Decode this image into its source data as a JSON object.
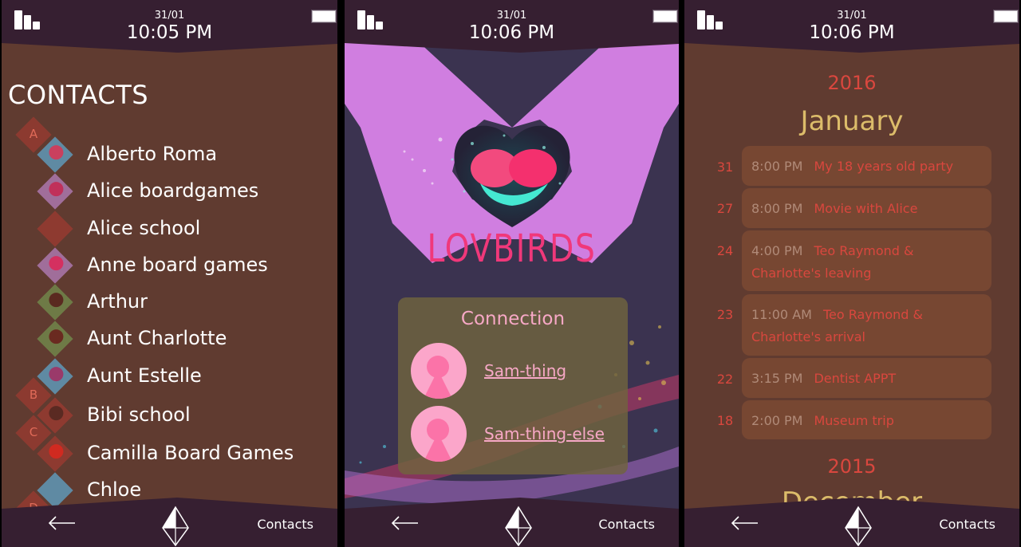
{
  "screens": [
    {
      "status": {
        "date": "31/01",
        "time": "10:05 PM",
        "signal_icon": "signal-bars-icon",
        "battery_icon": "battery-icon"
      },
      "title": "CONTACTS",
      "letters": [
        "A",
        "B",
        "C",
        "D"
      ],
      "contacts": [
        {
          "name": "Alberto Roma",
          "avatar_bg": "#5f8aa3",
          "avatar_fg": "#c9405e"
        },
        {
          "name": "Alice boardgames",
          "avatar_bg": "#a06e9a",
          "avatar_fg": "#c0305a"
        },
        {
          "name": "Alice school",
          "avatar_bg": "#8e3a30",
          "avatar_fg": "#8e3a30"
        },
        {
          "name": "Anne board games",
          "avatar_bg": "#a06e9a",
          "avatar_fg": "#d43060"
        },
        {
          "name": "Arthur",
          "avatar_bg": "#6e7a46",
          "avatar_fg": "#5a2a20"
        },
        {
          "name": "Aunt Charlotte",
          "avatar_bg": "#6e7a46",
          "avatar_fg": "#6a2a20"
        },
        {
          "name": "Aunt Estelle",
          "avatar_bg": "#5f8aa3",
          "avatar_fg": "#9a3a6a"
        },
        {
          "name": "Bibi school",
          "avatar_bg": "#8e3a30",
          "avatar_fg": "#5a2a22"
        },
        {
          "name": "Camilla Board Games",
          "avatar_bg": "#8e3a30",
          "avatar_fg": "#d02a20"
        },
        {
          "name": "Chloe",
          "avatar_bg": "#5f8aa3",
          "avatar_fg": "#5f8aa3"
        }
      ],
      "nav": {
        "back_icon": "back-arrow-icon",
        "home_icon": "diamond-home-icon",
        "label": "Contacts"
      }
    },
    {
      "status": {
        "date": "31/01",
        "time": "10:06 PM",
        "signal_icon": "signal-bars-icon",
        "battery_icon": "battery-icon"
      },
      "app_title": "LOVBIRDS",
      "connection": {
        "title": "Connection",
        "users": [
          {
            "name": "Sam-thing",
            "avatar_icon": "keyhole-avatar-icon"
          },
          {
            "name": "Sam-thing-else",
            "avatar_icon": "keyhole-avatar-icon"
          }
        ]
      },
      "nav": {
        "back_icon": "back-arrow-icon",
        "home_icon": "diamond-home-icon",
        "label": "Contacts"
      }
    },
    {
      "status": {
        "date": "31/01",
        "time": "10:06 PM",
        "signal_icon": "signal-bars-icon",
        "battery_icon": "battery-icon"
      },
      "sections": [
        {
          "year": "2016",
          "month": "January",
          "events": [
            {
              "day": "31",
              "time": "8:00 PM",
              "title": "My 18 years old party"
            },
            {
              "day": "27",
              "time": "8:00 PM",
              "title": "Movie with Alice"
            },
            {
              "day": "24",
              "time": "4:00 PM",
              "title": "Teo Raymond & Charlotte's leaving"
            },
            {
              "day": "23",
              "time": "11:00 AM",
              "title": "Teo Raymond & Charlotte's arrival"
            },
            {
              "day": "22",
              "time": "3:15 PM",
              "title": "Dentist APPT"
            },
            {
              "day": "18",
              "time": "2:00 PM",
              "title": "Museum trip"
            }
          ]
        },
        {
          "year": "2015",
          "month": "December",
          "events": []
        }
      ],
      "nav": {
        "back_icon": "back-arrow-icon",
        "home_icon": "diamond-home-icon",
        "label": "Contacts"
      }
    }
  ],
  "colors": {
    "bar_bg": "#361f31",
    "content_brown": "#603b30",
    "accent_red": "#d9473e",
    "month_gold": "#dcbc6a",
    "lov_pink": "#f0387a",
    "hand_purple": "#d07ee0"
  }
}
